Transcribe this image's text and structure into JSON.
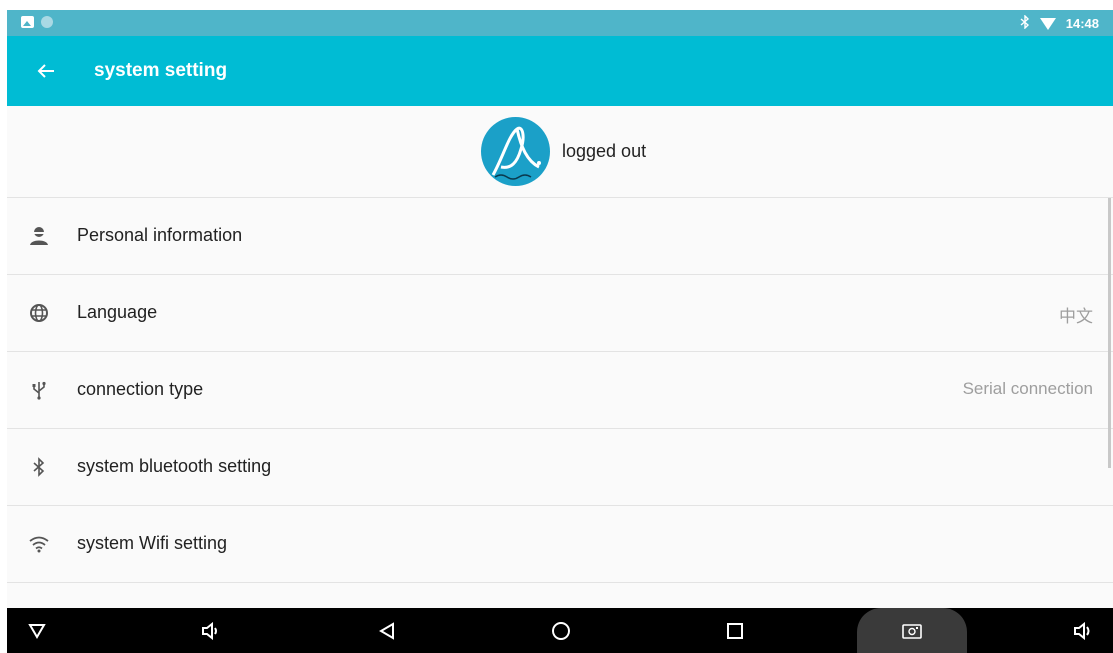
{
  "status_bar": {
    "time": "14:48",
    "icons": [
      "gallery-icon",
      "circle-notification-icon",
      "bluetooth-icon",
      "wifi-icon"
    ]
  },
  "app_bar": {
    "title": "system setting",
    "back_icon": "arrow-left-icon"
  },
  "profile": {
    "status": "logged out"
  },
  "settings": [
    {
      "icon": "person-icon",
      "label": "Personal information",
      "value": ""
    },
    {
      "icon": "globe-icon",
      "label": "Language",
      "value": "中文"
    },
    {
      "icon": "usb-icon",
      "label": "connection type",
      "value": "Serial connection"
    },
    {
      "icon": "bluetooth-icon",
      "label": "system bluetooth setting",
      "value": ""
    },
    {
      "icon": "wifi-icon",
      "label": "system Wifi setting",
      "value": ""
    }
  ],
  "nav_bar": {
    "buttons": [
      "hide-nav-icon",
      "volume-down-icon",
      "back-icon",
      "home-icon",
      "recents-icon",
      "screenshot-icon",
      "volume-up-icon"
    ]
  },
  "colors": {
    "app_bar": "#00bcd4",
    "status_bar": "#4fb5c9",
    "avatar": "#1ba0c8",
    "nav_bar": "#000000"
  }
}
